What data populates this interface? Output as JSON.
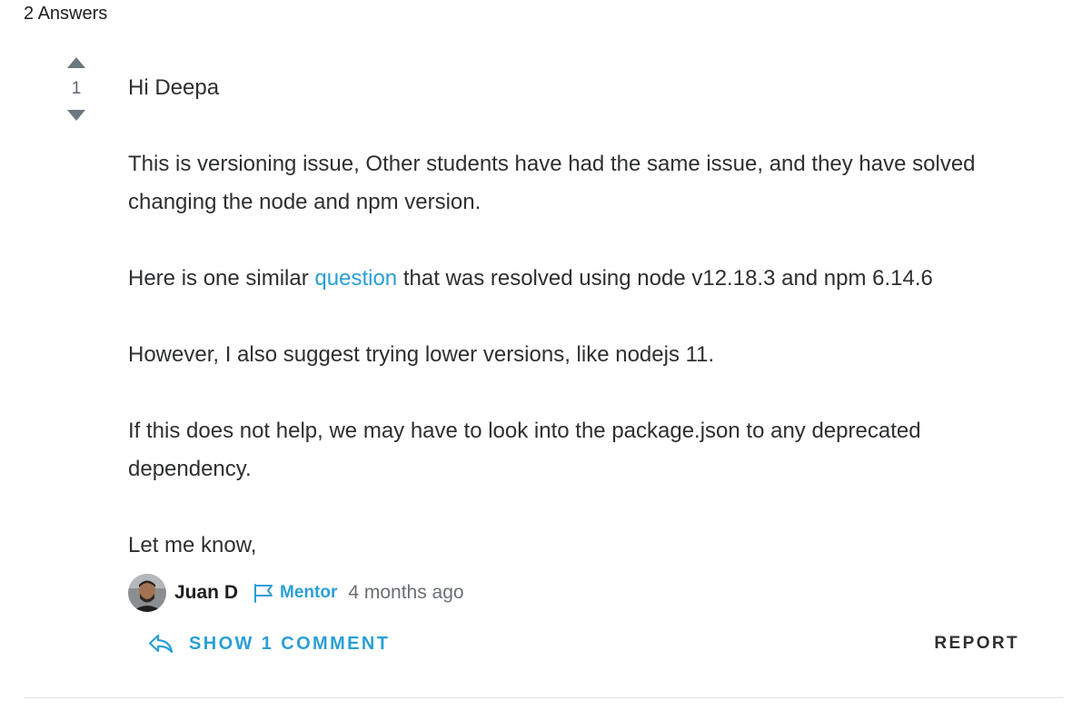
{
  "answers_count": "2 Answers",
  "answer": {
    "votes": "1",
    "paragraphs": [
      {
        "text": "Hi Deepa"
      },
      {
        "text": "This is versioning issue, Other students have had the same issue, and they have solved changing the node and npm version."
      },
      {
        "before": "Here is one similar ",
        "link": "question",
        "after": " that was resolved using node v12.18.3 and npm 6.14.6"
      },
      {
        "text": "However, I also suggest trying lower versions, like nodejs 11."
      },
      {
        "text": "If this does not help, we may have to look into the package.json to any deprecated dependency."
      },
      {
        "text": "Let me know,"
      }
    ],
    "author": {
      "name": "Juan D",
      "role": "Mentor",
      "time": "4 months ago"
    },
    "actions": {
      "show_comment": "SHOW 1 COMMENT",
      "report": "REPORT"
    }
  },
  "icons": {
    "upvote": "upvote-triangle-icon",
    "downvote": "downvote-triangle-icon",
    "mentor_badge": "flag-icon",
    "show_comment": "reply-arrow-icon"
  },
  "colors": {
    "accent": "#2a9fd6",
    "vote_arrow": "#6b7780",
    "muted_text": "#6a6f73",
    "body_text": "#2d2f31"
  }
}
